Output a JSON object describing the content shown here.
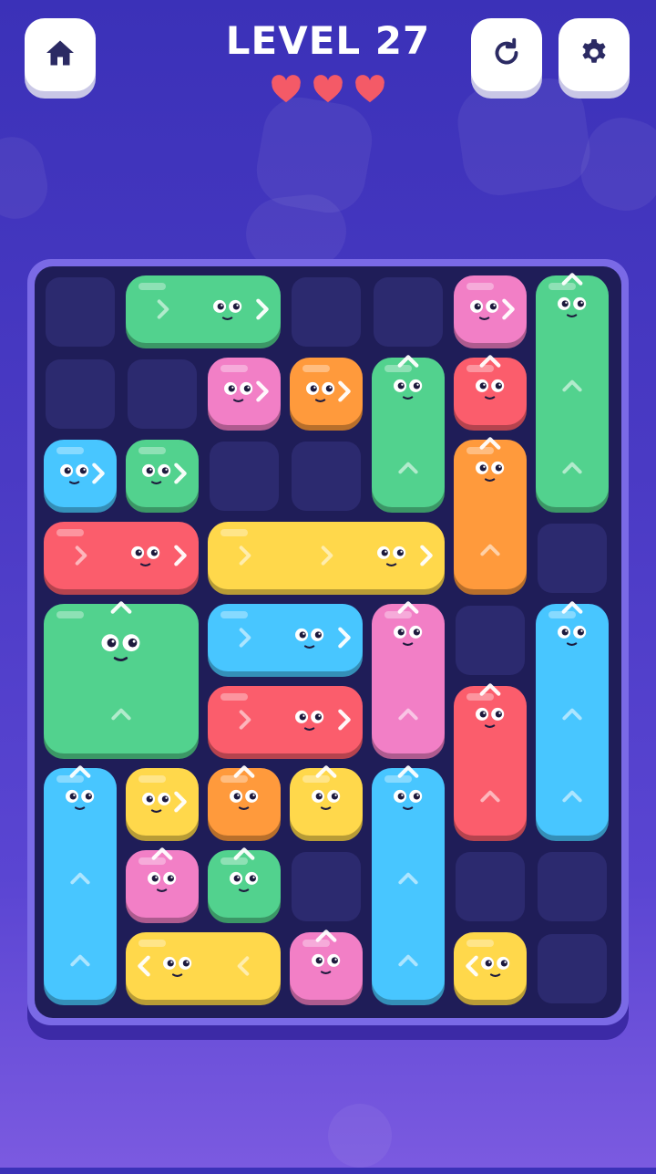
{
  "header": {
    "title": "LEVEL 27",
    "hearts": 3,
    "home_icon": "home-icon",
    "restart_icon": "restart-icon",
    "settings_icon": "gear-icon"
  },
  "colors": {
    "green": "#52d28e",
    "pink": "#f27fc6",
    "orange": "#ff9a3c",
    "red": "#fb5d6c",
    "blue": "#48c6ff",
    "yellow": "#ffd84b",
    "heart": "#f45a67"
  },
  "grid": {
    "cols": 7,
    "rows": 9
  },
  "blocks": [
    {
      "color": "green",
      "col": 1,
      "row": 0,
      "w": 2,
      "h": 1,
      "dir": "right"
    },
    {
      "color": "pink",
      "col": 5,
      "row": 0,
      "w": 1,
      "h": 1,
      "dir": "right"
    },
    {
      "color": "green",
      "col": 6,
      "row": 0,
      "w": 1,
      "h": 3,
      "dir": "up"
    },
    {
      "color": "pink",
      "col": 2,
      "row": 1,
      "w": 1,
      "h": 1,
      "dir": "right"
    },
    {
      "color": "orange",
      "col": 3,
      "row": 1,
      "w": 1,
      "h": 1,
      "dir": "right"
    },
    {
      "color": "green",
      "col": 4,
      "row": 1,
      "w": 1,
      "h": 2,
      "dir": "up"
    },
    {
      "color": "red",
      "col": 5,
      "row": 1,
      "w": 1,
      "h": 1,
      "dir": "up"
    },
    {
      "color": "blue",
      "col": 0,
      "row": 2,
      "w": 1,
      "h": 1,
      "dir": "right"
    },
    {
      "color": "green",
      "col": 1,
      "row": 2,
      "w": 1,
      "h": 1,
      "dir": "right"
    },
    {
      "color": "orange",
      "col": 5,
      "row": 2,
      "w": 1,
      "h": 2,
      "dir": "up"
    },
    {
      "color": "red",
      "col": 0,
      "row": 3,
      "w": 2,
      "h": 1,
      "dir": "right"
    },
    {
      "color": "yellow",
      "col": 2,
      "row": 3,
      "w": 3,
      "h": 1,
      "dir": "right"
    },
    {
      "color": "green",
      "col": 0,
      "row": 4,
      "w": 2,
      "h": 2,
      "dir": "up"
    },
    {
      "color": "blue",
      "col": 2,
      "row": 4,
      "w": 2,
      "h": 1,
      "dir": "right"
    },
    {
      "color": "pink",
      "col": 4,
      "row": 4,
      "w": 1,
      "h": 2,
      "dir": "up"
    },
    {
      "color": "blue",
      "col": 6,
      "row": 4,
      "w": 1,
      "h": 3,
      "dir": "up"
    },
    {
      "color": "red",
      "col": 2,
      "row": 5,
      "w": 2,
      "h": 1,
      "dir": "right"
    },
    {
      "color": "red",
      "col": 5,
      "row": 5,
      "w": 1,
      "h": 2,
      "dir": "up"
    },
    {
      "color": "blue",
      "col": 0,
      "row": 6,
      "w": 1,
      "h": 3,
      "dir": "up"
    },
    {
      "color": "yellow",
      "col": 1,
      "row": 6,
      "w": 1,
      "h": 1,
      "dir": "right"
    },
    {
      "color": "orange",
      "col": 2,
      "row": 6,
      "w": 1,
      "h": 1,
      "dir": "up"
    },
    {
      "color": "yellow",
      "col": 3,
      "row": 6,
      "w": 1,
      "h": 1,
      "dir": "up"
    },
    {
      "color": "blue",
      "col": 4,
      "row": 6,
      "w": 1,
      "h": 3,
      "dir": "up"
    },
    {
      "color": "pink",
      "col": 1,
      "row": 7,
      "w": 1,
      "h": 1,
      "dir": "up"
    },
    {
      "color": "green",
      "col": 2,
      "row": 7,
      "w": 1,
      "h": 1,
      "dir": "up"
    },
    {
      "color": "yellow",
      "col": 1,
      "row": 8,
      "w": 2,
      "h": 1,
      "dir": "left"
    },
    {
      "color": "pink",
      "col": 3,
      "row": 8,
      "w": 1,
      "h": 1,
      "dir": "up"
    },
    {
      "color": "yellow",
      "col": 5,
      "row": 8,
      "w": 1,
      "h": 1,
      "dir": "left"
    }
  ]
}
